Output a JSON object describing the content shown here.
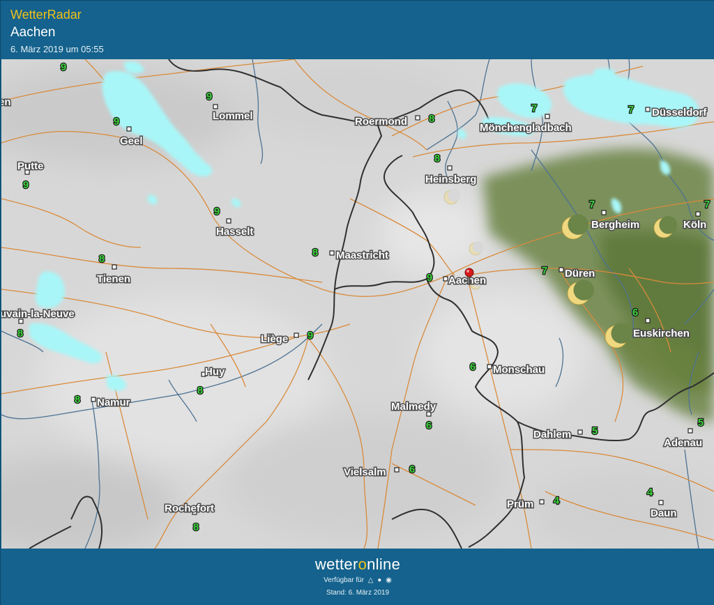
{
  "header": {
    "app_title": "WetterRadar",
    "city": "Aachen",
    "timestamp": "6. März 2019 um 05:55"
  },
  "footer": {
    "brand_pre": "wetter",
    "brand_o": "o",
    "brand_post": "nline",
    "available_label": "Verfügbar für",
    "platform_icons": [
      "android-icon",
      "apple-icon",
      "web-icon"
    ],
    "stand": "Stand: 6. März 2019"
  },
  "map": {
    "colors": {
      "background": "#d6d6d6",
      "precipitation": "#a9f6f8",
      "clear_sky_overlay": "#5f7a3a",
      "river": "#4a6f8e",
      "road": "#d98a3a",
      "border": "#2d2d2d",
      "temperature_text": "#3bd63b"
    },
    "selected_location": "Aachen",
    "cities": [
      {
        "name": "Lommel",
        "temp": "9"
      },
      {
        "name": "Geel",
        "temp": "9"
      },
      {
        "name": "Putte",
        "temp": "9"
      },
      {
        "name": "Hasselt",
        "temp": "9"
      },
      {
        "name": "Tienen",
        "temp": "8"
      },
      {
        "name": "uvain-la-Neuve",
        "temp": "8"
      },
      {
        "name": "Maastricht",
        "temp": "8"
      },
      {
        "name": "Liège",
        "temp": "9"
      },
      {
        "name": "Huy",
        "temp": "8"
      },
      {
        "name": "Namur",
        "temp": "8"
      },
      {
        "name": "Rochefort",
        "temp": "8"
      },
      {
        "name": "Roermond",
        "temp": "8"
      },
      {
        "name": "Heinsberg",
        "temp": "8"
      },
      {
        "name": "Aachen",
        "temp": "9"
      },
      {
        "name": "Mönchengladbach",
        "temp": "7"
      },
      {
        "name": "Düsseldorf",
        "temp": "7"
      },
      {
        "name": "Bergheim",
        "temp": "7"
      },
      {
        "name": "Köln",
        "temp": "7"
      },
      {
        "name": "Düren",
        "temp": "7"
      },
      {
        "name": "Euskirchen",
        "temp": "6"
      },
      {
        "name": "Monschau",
        "temp": "6"
      },
      {
        "name": "Malmedy",
        "temp": "6"
      },
      {
        "name": "Vielsalm",
        "temp": "6"
      },
      {
        "name": "Dahlem",
        "temp": "5"
      },
      {
        "name": "Adenau",
        "temp": "5"
      },
      {
        "name": "Prüm",
        "temp": "4"
      },
      {
        "name": "Daun",
        "temp": "4"
      }
    ],
    "partial_labels": [
      {
        "text": "en"
      }
    ],
    "unlabeled_temps": [
      "9"
    ],
    "weather_icons": [
      "moon-icon",
      "moon-icon",
      "moon-icon",
      "moon-icon",
      "moon-icon",
      "moon-icon",
      "moon-icon"
    ]
  }
}
